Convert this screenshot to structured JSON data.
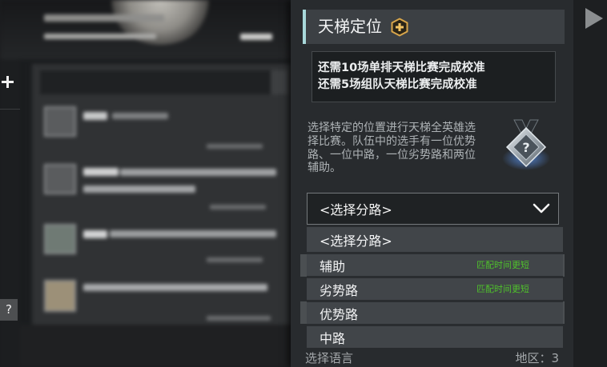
{
  "icons": {
    "add_button": "plus-icon",
    "title_badge": "gold-plus-icon",
    "rank_medal": "uncalibrated-medal-icon",
    "select_arrow": "chevron-down-icon",
    "side_play": "play-icon"
  },
  "colors": {
    "panel_background": "#282b2e",
    "header_accent": "#a8d8da",
    "badge_gold": "#d9a64a",
    "note_green": "#4fc22b",
    "option_background": "#414549"
  },
  "left_panel": {
    "help_label": "?"
  },
  "ranked": {
    "title": "天梯定位",
    "calibration_lines": [
      "还需10场单排天梯比赛完成校准",
      "还需5场组队天梯比赛完成校准"
    ],
    "description_lines": [
      "选择特定的位置进行天梯全英雄选",
      "择比赛。队伍中的选手有一位优势",
      "路、一位中路，一位劣势路和两位",
      "辅助。"
    ],
    "medal_symbol": "?",
    "role_select": {
      "selected": "<选择分路>",
      "options": [
        {
          "label": "<选择分路>"
        },
        {
          "label": "辅助",
          "note": "匹配时间更短"
        },
        {
          "label": "劣势路",
          "note": "匹配时间更短"
        },
        {
          "label": "优势路"
        },
        {
          "label": "中路"
        }
      ]
    },
    "footer": {
      "language_label": "选择语言",
      "region_label": "地区：3"
    }
  }
}
